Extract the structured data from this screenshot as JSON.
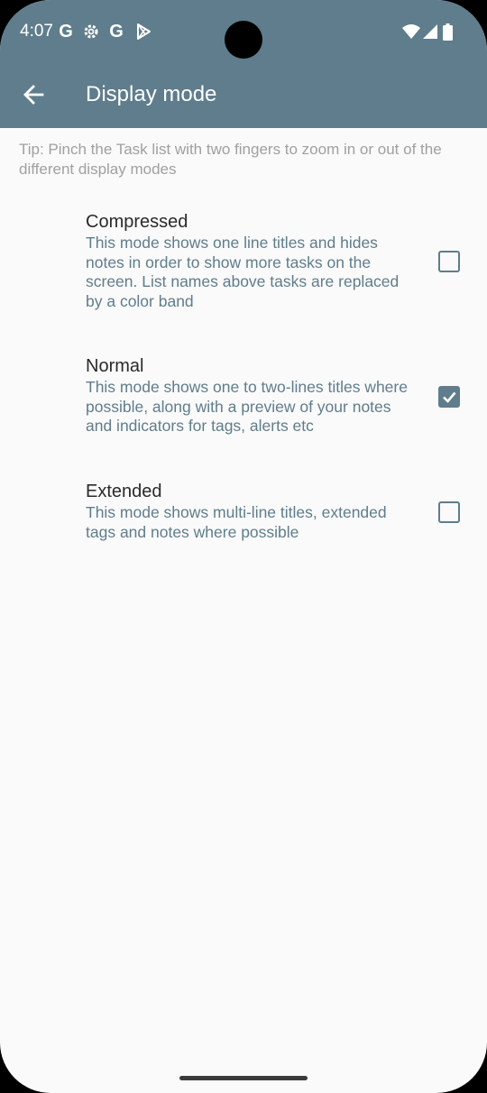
{
  "status": {
    "time": "4:07"
  },
  "appbar": {
    "title": "Display mode"
  },
  "tip": "Tip: Pinch the Task list with two fingers to zoom in or out of the different display modes",
  "options": [
    {
      "title": "Compressed",
      "description": "This mode shows one line titles and hides notes in order to show more tasks on the screen. List names above tasks are replaced by a color band",
      "checked": false
    },
    {
      "title": "Normal",
      "description": "This mode shows one to two-lines titles where possible, along with a preview of your notes and indicators for tags, alerts etc",
      "checked": true
    },
    {
      "title": "Extended",
      "description": "This mode shows multi-line titles, extended tags and notes where possible",
      "checked": false
    }
  ],
  "colors": {
    "accent": "#5f7d8c",
    "background": "#fafafa"
  }
}
